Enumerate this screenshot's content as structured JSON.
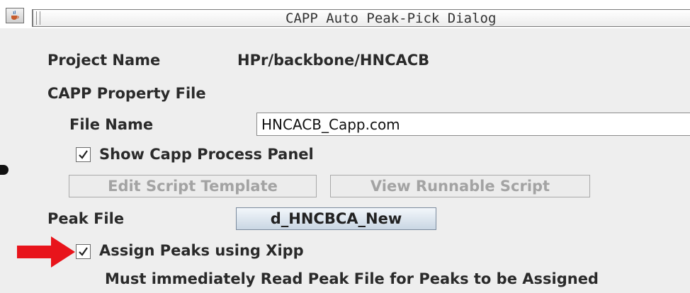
{
  "window": {
    "title": "CAPP Auto Peak-Pick Dialog",
    "app_icon": "java-cup-icon"
  },
  "project": {
    "label": "Project Name",
    "value": "HPr/backbone/HNCACB"
  },
  "capp_property": {
    "heading": "CAPP Property File",
    "file_name_label": "File Name",
    "file_name_value": "HNCACB_Capp.com",
    "show_panel_label": "Show Capp Process Panel",
    "show_panel_checked": true
  },
  "script_buttons": {
    "edit_label": "Edit Script Template",
    "view_label": "View Runnable Script"
  },
  "peak_file": {
    "label": "Peak File",
    "button_label": "d_HNCBCA_New"
  },
  "assign": {
    "label": "Assign Peaks using Xipp",
    "checked": true,
    "note": "Must immediately Read Peak File for Peaks to be Assigned"
  },
  "colors": {
    "panel": "#eeeeee",
    "arrow": "#e8141b",
    "button_gradient_top": "#f3f7fb",
    "button_gradient_bottom": "#c9d6e3"
  }
}
